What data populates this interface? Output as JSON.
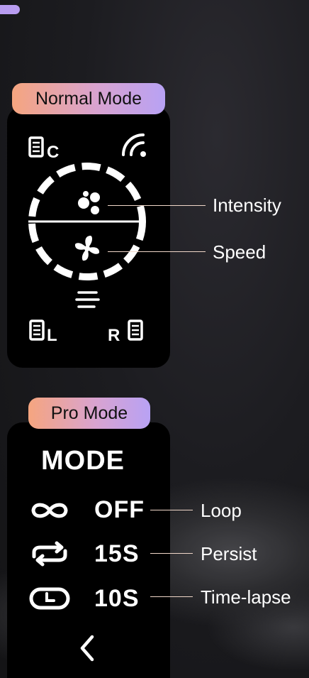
{
  "normal_mode": {
    "title": "Normal Mode",
    "icons": [
      "list-c-icon",
      "signal-icon",
      "particles-icon",
      "fan-icon",
      "wind-icon",
      "list-l-icon",
      "list-r-icon"
    ],
    "corner_letters": {
      "top_left": "C",
      "bottom_left": "L",
      "bottom_right": "R"
    },
    "callouts": [
      {
        "id": "intensity",
        "label": "Intensity"
      },
      {
        "id": "speed",
        "label": "Speed"
      }
    ]
  },
  "pro_mode": {
    "title": "Pro Mode",
    "heading": "MODE",
    "rows": [
      {
        "icon": "infinity-icon",
        "value": "OFF",
        "label": "Loop"
      },
      {
        "icon": "repeat-icon",
        "value": "15S",
        "label": "Persist"
      },
      {
        "icon": "timer-icon",
        "value": "10S",
        "label": "Time-lapse"
      }
    ],
    "back_icon": "chevron-left-icon"
  },
  "colors": {
    "pill_gradient_start": "#f5a57f",
    "pill_gradient_end": "#b8a2f4",
    "accent_pill": "#b89cf0",
    "panel": "#000000",
    "callout_line": "#f0d7c9"
  }
}
